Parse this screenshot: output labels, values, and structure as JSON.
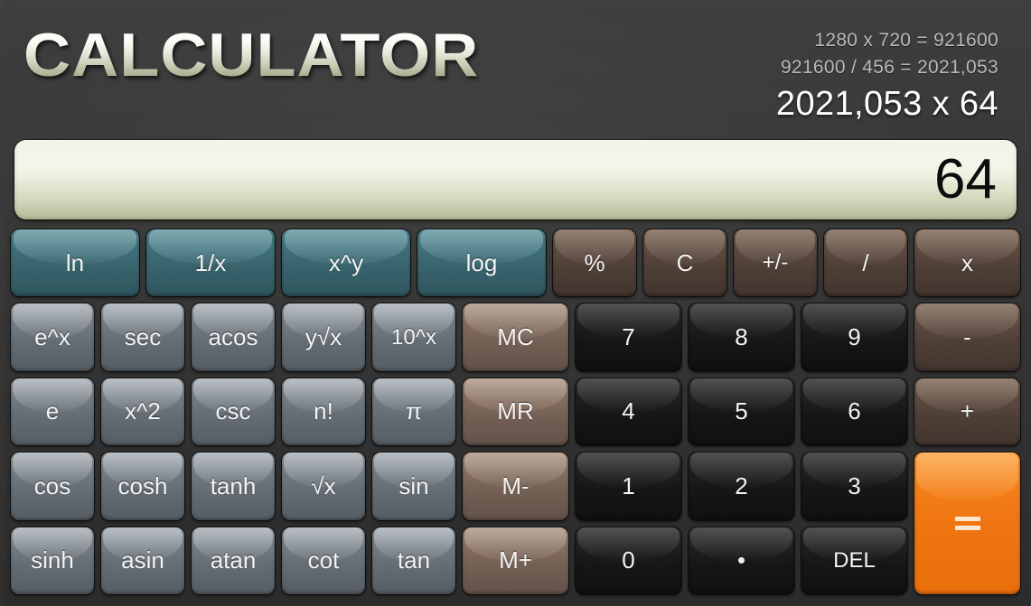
{
  "app": {
    "title": "CALCULATOR",
    "accent_orange": "#f5821a",
    "accent_teal": "#3f6f78",
    "accent_brown": "#5b4a40",
    "background": "#3a3a3a",
    "display_bg": "#eef0e0"
  },
  "history": {
    "line1": "1280 x 720 = 921600",
    "line2": "921600 / 456 = 2021,053",
    "current": "2021,053 x 64"
  },
  "display": {
    "value": "64"
  },
  "keys": {
    "r1": [
      {
        "label": "ln",
        "style": "teal",
        "name": "key-ln"
      },
      {
        "label": "1/x",
        "style": "teal",
        "name": "key-reciprocal"
      },
      {
        "label": "x^y",
        "style": "teal",
        "name": "key-power"
      },
      {
        "label": "log",
        "style": "teal",
        "name": "key-log"
      },
      {
        "label": "%",
        "style": "brown",
        "name": "key-percent"
      },
      {
        "label": "C",
        "style": "brown",
        "name": "key-clear"
      },
      {
        "label": "+/-",
        "style": "brown",
        "name": "key-sign-toggle"
      },
      {
        "label": "/",
        "style": "brown",
        "name": "key-divide"
      },
      {
        "label": "x",
        "style": "brown",
        "name": "key-multiply"
      }
    ],
    "r2": [
      {
        "label": "e^x",
        "style": "slate",
        "name": "key-exp"
      },
      {
        "label": "sec",
        "style": "slate",
        "name": "key-sec"
      },
      {
        "label": "acos",
        "style": "slate",
        "name": "key-acos"
      },
      {
        "label": "y√x",
        "style": "slate",
        "name": "key-nth-root"
      },
      {
        "label": "10^x",
        "style": "slate",
        "name": "key-ten-power"
      },
      {
        "label": "MC",
        "style": "taupe",
        "name": "key-memory-clear"
      },
      {
        "label": "7",
        "style": "dark",
        "name": "key-7"
      },
      {
        "label": "8",
        "style": "dark",
        "name": "key-8"
      },
      {
        "label": "-",
        "style": "brown",
        "name": "key-subtract"
      }
    ],
    "r2_nine": {
      "label": "9",
      "style": "dark",
      "name": "key-9"
    },
    "r3": [
      {
        "label": "e",
        "style": "slate",
        "name": "key-euler"
      },
      {
        "label": "x^2",
        "style": "slate",
        "name": "key-square"
      },
      {
        "label": "csc",
        "style": "slate",
        "name": "key-csc"
      },
      {
        "label": "n!",
        "style": "slate",
        "name": "key-factorial"
      },
      {
        "label": "π",
        "style": "slate",
        "name": "key-pi"
      },
      {
        "label": "MR",
        "style": "taupe",
        "name": "key-memory-recall"
      },
      {
        "label": "4",
        "style": "dark",
        "name": "key-4"
      },
      {
        "label": "5",
        "style": "dark",
        "name": "key-5"
      },
      {
        "label": "6",
        "style": "dark",
        "name": "key-6"
      },
      {
        "label": "+",
        "style": "brown",
        "name": "key-add"
      }
    ],
    "r4": [
      {
        "label": "cos",
        "style": "slate",
        "name": "key-cos"
      },
      {
        "label": "cosh",
        "style": "slate",
        "name": "key-cosh"
      },
      {
        "label": "tanh",
        "style": "slate",
        "name": "key-tanh"
      },
      {
        "label": "√x",
        "style": "slate",
        "name": "key-sqrt"
      },
      {
        "label": "sin",
        "style": "slate",
        "name": "key-sin"
      },
      {
        "label": "M-",
        "style": "taupe",
        "name": "key-memory-subtract"
      },
      {
        "label": "1",
        "style": "dark",
        "name": "key-1"
      },
      {
        "label": "2",
        "style": "dark",
        "name": "key-2"
      },
      {
        "label": "3",
        "style": "dark",
        "name": "key-3"
      }
    ],
    "r5": [
      {
        "label": "sinh",
        "style": "slate",
        "name": "key-sinh"
      },
      {
        "label": "asin",
        "style": "slate",
        "name": "key-asin"
      },
      {
        "label": "atan",
        "style": "slate",
        "name": "key-atan"
      },
      {
        "label": "cot",
        "style": "slate",
        "name": "key-cot"
      },
      {
        "label": "tan",
        "style": "slate",
        "name": "key-tan"
      },
      {
        "label": "M+",
        "style": "taupe",
        "name": "key-memory-add"
      },
      {
        "label": "0",
        "style": "dark",
        "name": "key-0"
      },
      {
        "label": ".",
        "style": "dark",
        "name": "key-decimal-point"
      },
      {
        "label": "DEL",
        "style": "dark",
        "name": "key-delete"
      }
    ],
    "equals": {
      "label": "=",
      "style": "orange",
      "name": "key-equals"
    }
  }
}
